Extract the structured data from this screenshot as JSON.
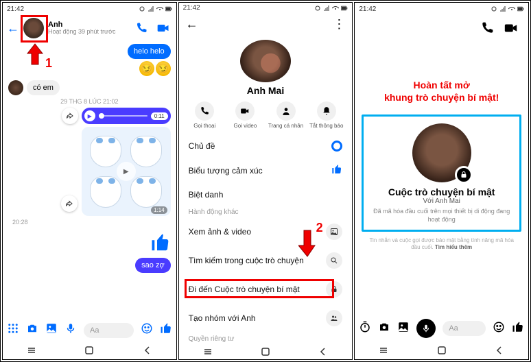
{
  "status": {
    "time": "21:42"
  },
  "s1": {
    "contact": "Anh",
    "sub": "Hoạt động 39 phút trước",
    "hello": "helo helo",
    "coem": "có em",
    "ts1": "29 THG 8 LÚC 21:02",
    "vtime": "0:11",
    "stime": "1:14",
    "ts2": "20:28",
    "reply": "sao zợ",
    "placeholder": "Aa",
    "marker": "1"
  },
  "s2": {
    "name": "Anh Mai",
    "act": {
      "a": "Gọi thoại",
      "b": "Gọi video",
      "c": "Trang cá nhân",
      "d": "Tắt thông báo"
    },
    "m": {
      "chude": "Chủ đề",
      "bieu": "Biểu tượng cảm xúc",
      "biet": "Biệt danh",
      "hanh": "Hành động khác",
      "xem": "Xem ảnh & video",
      "tim": "Tìm kiếm trong cuộc trò chuyện",
      "di": "Đi đến Cuộc trò chuyện bí mật",
      "tao": "Tạo nhóm với Anh",
      "quyen": "Quyền riêng tư"
    },
    "marker": "2"
  },
  "s3": {
    "banner1": "Hoàn tất mở",
    "banner2": "khung trò chuyện bí mật!",
    "title": "Cuộc trò chuyện bí mật",
    "with": "Với Anh Mai",
    "desc": "Đã mã hóa đầu cuối trên mọi thiết bị di động đang hoạt động",
    "foot1": "Tin nhắn và cuộc gọi được bảo mật bằng tính năng mã hóa đầu cuối.",
    "foot2": "Tìm hiểu thêm",
    "placeholder": "Aa"
  }
}
